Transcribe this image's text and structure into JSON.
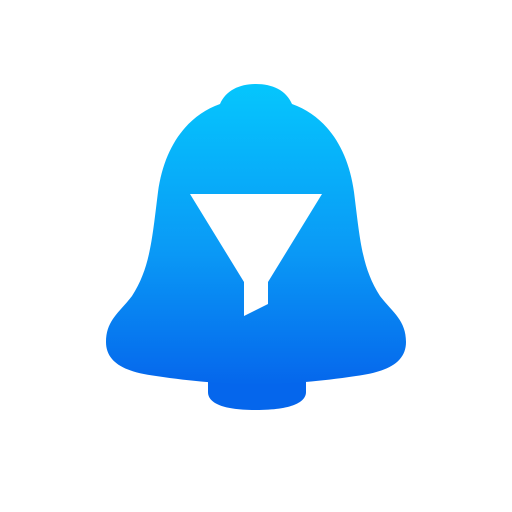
{
  "app_icon": {
    "name": "bell-filter-icon",
    "colors": {
      "gradient_top": "#05C6FD",
      "gradient_mid": "#0A9AF6",
      "gradient_bottom": "#0567EC",
      "clapper": "#0566EC",
      "funnel": "#FFFFFF",
      "background": "#FFFFFF"
    }
  }
}
